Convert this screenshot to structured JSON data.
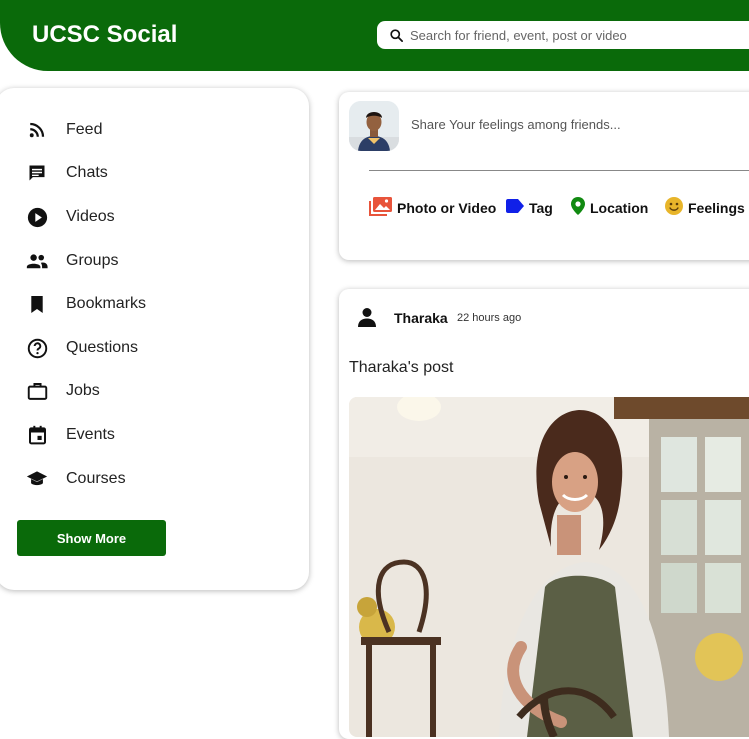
{
  "header": {
    "brand": "UCSC Social",
    "search_placeholder": "Search for friend, event, post or video",
    "search_value": "",
    "accent": "#0a6a0a"
  },
  "sidebar": {
    "items": [
      {
        "label": "Feed",
        "icon": "rss-icon"
      },
      {
        "label": "Chats",
        "icon": "chat-icon"
      },
      {
        "label": "Videos",
        "icon": "play-circle-icon"
      },
      {
        "label": "Groups",
        "icon": "people-icon"
      },
      {
        "label": "Bookmarks",
        "icon": "bookmark-icon"
      },
      {
        "label": "Questions",
        "icon": "help-circle-icon"
      },
      {
        "label": "Jobs",
        "icon": "briefcase-icon"
      },
      {
        "label": "Events",
        "icon": "calendar-icon"
      },
      {
        "label": "Courses",
        "icon": "school-icon"
      }
    ],
    "show_more_label": "Show More"
  },
  "composer": {
    "placeholder": "Share Your feelings among friends...",
    "value": "",
    "options": [
      {
        "label": "Photo or Video",
        "icon": "photo-icon",
        "color": "#e8543b"
      },
      {
        "label": "Tag",
        "icon": "label-icon",
        "color": "#1020e8"
      },
      {
        "label": "Location",
        "icon": "location-pin-icon",
        "color": "#118a11"
      },
      {
        "label": "Feelings",
        "icon": "smiley-icon",
        "color": "#e8b52a"
      }
    ]
  },
  "post": {
    "author": "Tharaka",
    "time": "22 hours ago",
    "text": "Tharaka's post"
  }
}
